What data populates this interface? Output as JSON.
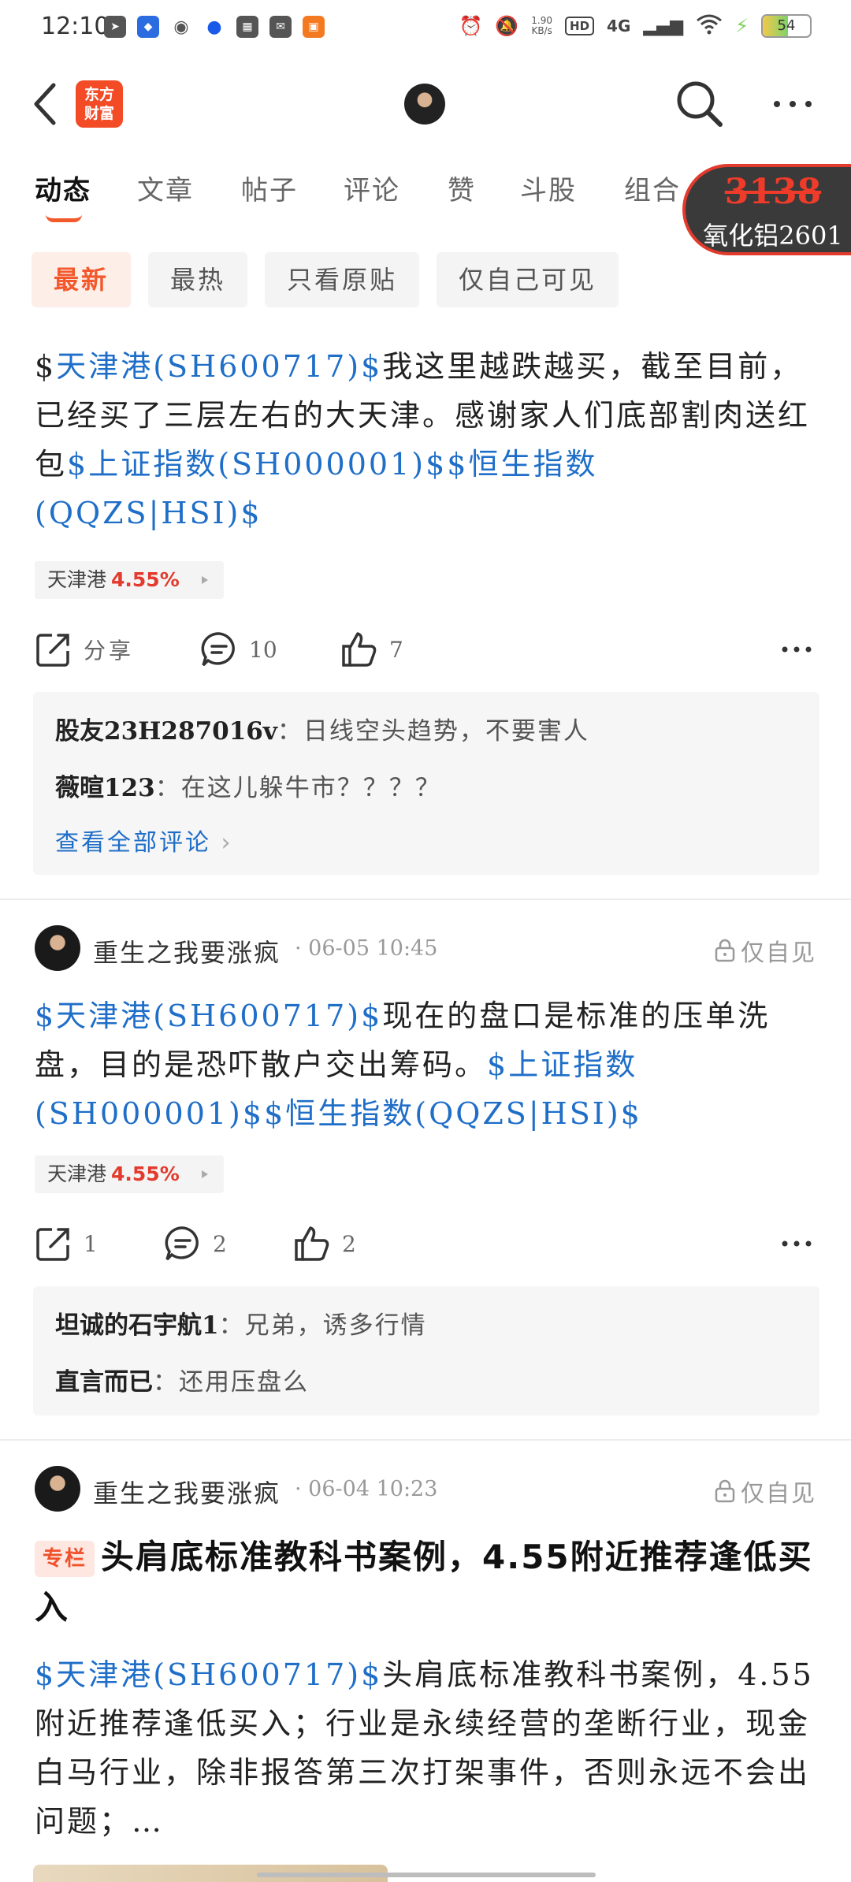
{
  "status_bar": {
    "time": "12:10",
    "speed_top": "1.90",
    "speed_unit": "KB/s",
    "hd": "HD",
    "network": "4G",
    "battery": "54",
    "battery_level": 0.54
  },
  "header": {
    "logo_line1": "东方",
    "logo_line2": "财富"
  },
  "tabs": [
    "动态",
    "文章",
    "帖子",
    "评论",
    "赞",
    "斗股",
    "组合"
  ],
  "floating_quote": {
    "value": "3138",
    "name": "氧化铝2601"
  },
  "filters": [
    "最新",
    "最热",
    "只看原贴",
    "仅自己可见"
  ],
  "posts": [
    {
      "body": [
        {
          "t": "$"
        },
        {
          "t": "天津港",
          "link": true
        },
        {
          "t": "(SH600717)$",
          "link": true
        },
        {
          "t": "我这里越跌越买，截至目前，已经买了三层左右的大天津。"
        },
        {
          "t": "感谢家人们底部割肉送红包"
        },
        {
          "t": "$上证指数",
          "link": true
        },
        {
          "t": "(SH000001)$",
          "link": true
        },
        {
          "t": "$",
          "link": true
        },
        {
          "t": "恒生指数",
          "link": true
        },
        {
          "t": "(QQZS|HSI)$",
          "link": true
        }
      ],
      "stock_tag": {
        "name": "天津港",
        "pct": "4.55%"
      },
      "actions": {
        "share": "分享",
        "comments": "10",
        "likes": "7"
      },
      "comments": [
        {
          "who": "股友23H287016v",
          "sep": "：",
          "text": "日线空头趋势，不要害人"
        },
        {
          "who": "薇暄123",
          "sep": "：",
          "text": "在这儿躲牛市？？？？"
        }
      ],
      "see_all": "查看全部评论"
    },
    {
      "author": "重生之我要涨疯",
      "time": "· 06-05 10:45",
      "privacy": "仅自见",
      "body": [
        {
          "t": "$天津港",
          "link": true
        },
        {
          "t": "(SH600717)$",
          "link": true
        },
        {
          "t": "现在的盘口是标准的压单洗盘，目的是恐吓散户交出筹码。"
        },
        {
          "t": "$上证指数",
          "link": true
        },
        {
          "t": "(SH000001)$",
          "link": true
        },
        {
          "t": "$",
          "link": true
        },
        {
          "t": "恒生指数",
          "link": true
        },
        {
          "t": "(QQZS|HSI)$",
          "link": true
        }
      ],
      "stock_tag": {
        "name": "天津港",
        "pct": "4.55%"
      },
      "actions": {
        "share": "1",
        "comments": "2",
        "likes": "2"
      },
      "comments": [
        {
          "who": "坦诚的石宇航1",
          "sep": "：",
          "text": "兄弟，诱多行情"
        },
        {
          "who": "直言而已",
          "sep": "：",
          "text": "还用压盘么"
        }
      ]
    },
    {
      "author": "重生之我要涨疯",
      "time": "· 06-04 10:23",
      "privacy": "仅自见",
      "badge": "专栏",
      "title": "头肩底标准教科书案例，4.55附近推荐逢低买入",
      "body": [
        {
          "t": "$天津港",
          "link": true
        },
        {
          "t": "(SH600717)$",
          "link": true
        },
        {
          "t": "头肩底标准教科书案例，4.55附近推荐逢低买入；"
        },
        {
          "t": "行业是永续经营的垄断行业，现金白马行业，除非报答第三次打架事件，否则永远不会出问题；…"
        }
      ]
    }
  ]
}
